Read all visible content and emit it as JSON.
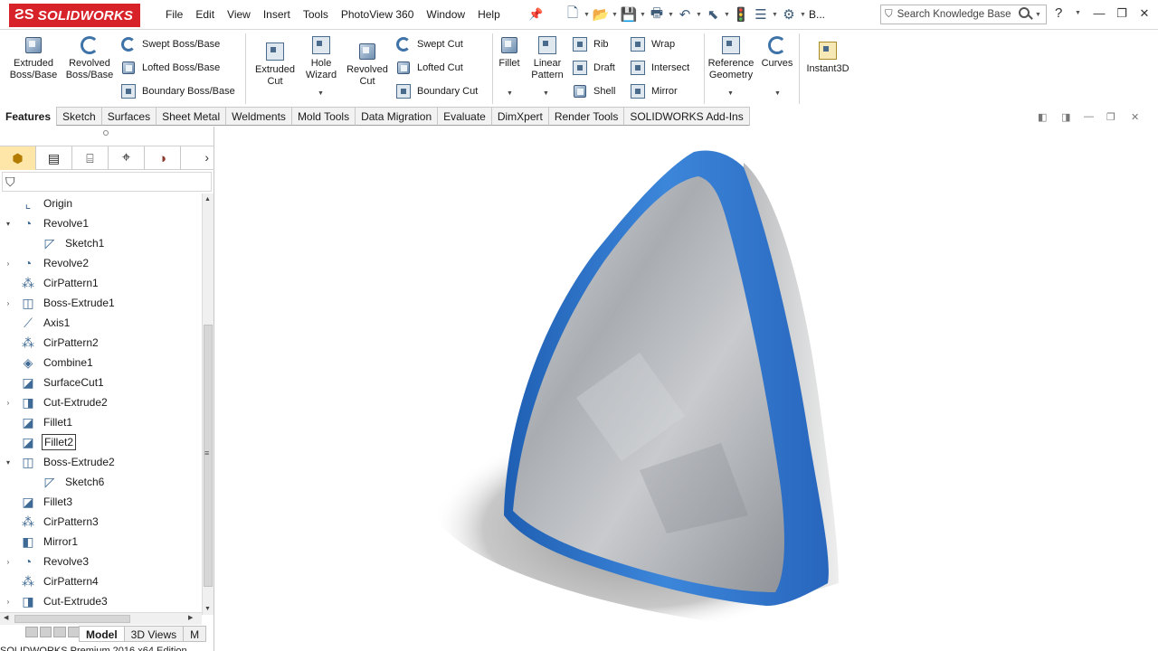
{
  "app": {
    "logo_text": "SOLIDWORKS",
    "brand_color": "#d8222a"
  },
  "menu": [
    "File",
    "Edit",
    "View",
    "Insert",
    "Tools",
    "PhotoView 360",
    "Window",
    "Help"
  ],
  "quick_access": {
    "truncated_label": "B..."
  },
  "search": {
    "placeholder": "Search Knowledge Base"
  },
  "ribbon": {
    "extruded_boss": "Extruded Boss/Base",
    "revolved_boss": "Revolved Boss/Base",
    "swept_boss": "Swept Boss/Base",
    "lofted_boss": "Lofted Boss/Base",
    "boundary_boss": "Boundary Boss/Base",
    "extruded_cut": "Extruded Cut",
    "hole_wizard": "Hole Wizard",
    "revolved_cut": "Revolved Cut",
    "swept_cut": "Swept Cut",
    "lofted_cut": "Lofted Cut",
    "boundary_cut": "Boundary Cut",
    "fillet": "Fillet",
    "linear_pattern": "Linear Pattern",
    "rib": "Rib",
    "draft": "Draft",
    "shell": "Shell",
    "wrap": "Wrap",
    "intersect": "Intersect",
    "mirror": "Mirror",
    "reference_geometry": "Reference Geometry",
    "curves": "Curves",
    "instant3d": "Instant3D"
  },
  "tabs": [
    "Features",
    "Sketch",
    "Surfaces",
    "Sheet Metal",
    "Weldments",
    "Mold Tools",
    "Data Migration",
    "Evaluate",
    "DimXpert",
    "Render Tools",
    "SOLIDWORKS Add-Ins"
  ],
  "active_tab": "Features",
  "tree": [
    {
      "label": "Origin",
      "icon": "origin-icon",
      "toggle": "",
      "child": false
    },
    {
      "label": "Revolve1",
      "icon": "revolve-icon",
      "toggle": "▾",
      "child": false
    },
    {
      "label": "Sketch1",
      "icon": "sketch-icon",
      "toggle": "",
      "child": true
    },
    {
      "label": "Revolve2",
      "icon": "revolve-icon",
      "toggle": "›",
      "child": false
    },
    {
      "label": "CirPattern1",
      "icon": "circular-pattern-icon",
      "toggle": "",
      "child": false
    },
    {
      "label": "Boss-Extrude1",
      "icon": "extrude-icon",
      "toggle": "›",
      "child": false
    },
    {
      "label": "Axis1",
      "icon": "axis-icon",
      "toggle": "",
      "child": false
    },
    {
      "label": "CirPattern2",
      "icon": "circular-pattern-icon",
      "toggle": "",
      "child": false
    },
    {
      "label": "Combine1",
      "icon": "combine-icon",
      "toggle": "",
      "child": false
    },
    {
      "label": "SurfaceCut1",
      "icon": "surface-cut-icon",
      "toggle": "",
      "child": false
    },
    {
      "label": "Cut-Extrude2",
      "icon": "cut-extrude-icon",
      "toggle": "›",
      "child": false
    },
    {
      "label": "Fillet1",
      "icon": "fillet-icon",
      "toggle": "",
      "child": false
    },
    {
      "label": "Fillet2",
      "icon": "fillet-icon",
      "toggle": "",
      "child": false,
      "selected": true
    },
    {
      "label": "Boss-Extrude2",
      "icon": "extrude-icon",
      "toggle": "▾",
      "child": false
    },
    {
      "label": "Sketch6",
      "icon": "sketch-icon",
      "toggle": "",
      "child": true
    },
    {
      "label": "Fillet3",
      "icon": "fillet-icon",
      "toggle": "",
      "child": false
    },
    {
      "label": "CirPattern3",
      "icon": "circular-pattern-icon",
      "toggle": "",
      "child": false
    },
    {
      "label": "Mirror1",
      "icon": "mirror-icon",
      "toggle": "",
      "child": false
    },
    {
      "label": "Revolve3",
      "icon": "revolve-icon",
      "toggle": "›",
      "child": false
    },
    {
      "label": "CirPattern4",
      "icon": "circular-pattern-icon",
      "toggle": "",
      "child": false
    },
    {
      "label": "Cut-Extrude3",
      "icon": "cut-extrude-icon",
      "toggle": "›",
      "child": false
    }
  ],
  "model_tabs": [
    "Model",
    "3D Views",
    "M"
  ],
  "status": {
    "text": "SOLIDWORKS Premium 2016 x64 Edition"
  },
  "colors": {
    "model_rim": "#2e77d0",
    "model_face": "#b9bcc0",
    "selection": "#fde6a8"
  }
}
